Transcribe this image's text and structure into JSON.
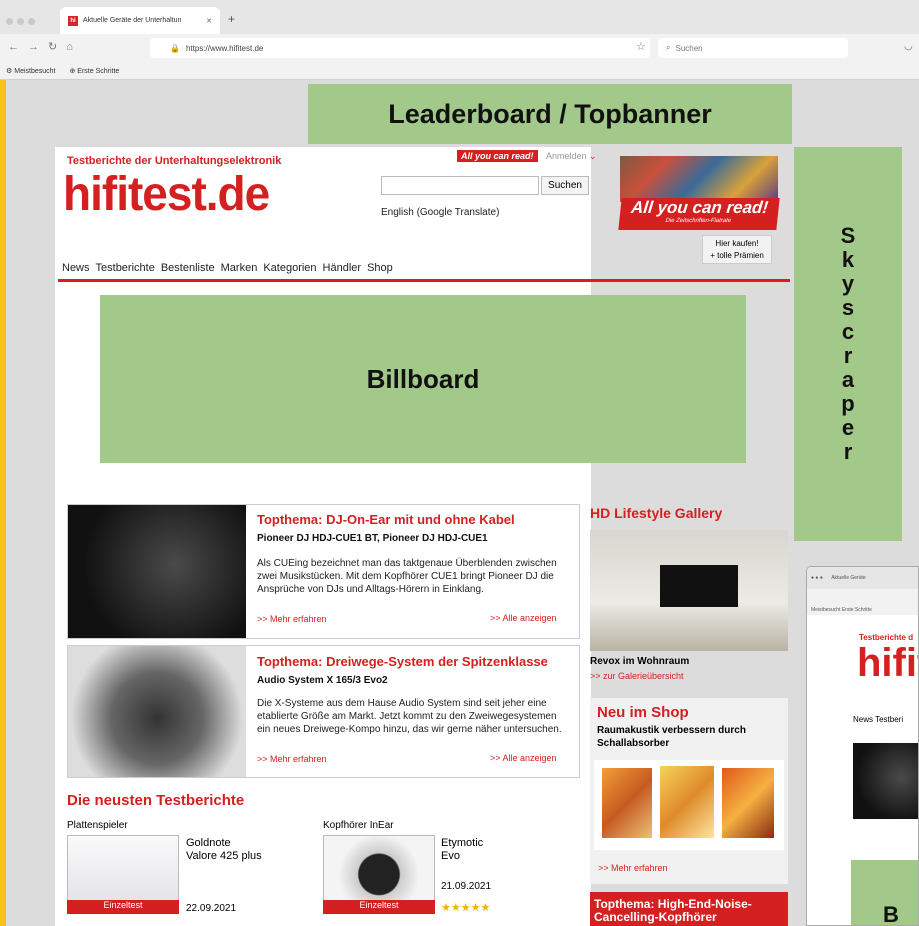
{
  "browser": {
    "tab_title": "Aktuelle Geräte der Unterhaltun",
    "favicon": "hi",
    "url": "https://www.hifitest.de",
    "search_placeholder": "Suchen",
    "bookmarks": [
      "Meistbesucht",
      "Erste Schritte"
    ]
  },
  "ads": {
    "leaderboard": "Leaderboard / Topbanner",
    "billboard": "Billboard",
    "skyscraper": [
      "S",
      "k",
      "y",
      "s",
      "c",
      "r",
      "a",
      "p",
      "e",
      "r"
    ]
  },
  "site": {
    "tagline": "Testberichte der Unterhaltungselektronik",
    "logo": "hifitest.de",
    "promo_tag": "All you can read!",
    "login": "Anmelden",
    "search_button": "Suchen",
    "translate": "English (Google Translate)",
    "magazine_banner": "All you can read!",
    "magazine_sub": "Die Zeitschriften-Flatrate",
    "buy_line1": "Hier kaufen!",
    "buy_line2": "+ tolle Prämien",
    "nav": [
      "News",
      "Testberichte",
      "Bestenliste",
      "Marken",
      "Kategorien",
      "Händler",
      "Shop"
    ]
  },
  "topics": [
    {
      "title": "Topthema: DJ-On-Ear mit und ohne Kabel",
      "subtitle": "Pioneer DJ HDJ-CUE1 BT, Pioneer DJ HDJ-CUE1",
      "text": "Als CUEing bezeichnet man das taktgenaue Überblenden zwischen zwei Musikstücken. Mit dem Kopfhörer CUE1 bringt Pioneer DJ die Ansprüche von DJs und Alltags-Hörern in Einklang.",
      "more": ">> Mehr erfahren",
      "all": ">> Alle anzeigen"
    },
    {
      "title": "Topthema: Dreiwege-System der Spitzenklasse",
      "subtitle": "Audio System X 165/3 Evo2",
      "text": "Die X-Systeme aus dem Hause Audio System sind seit jeher eine etablierte Größe am Markt. Jetzt kommt zu den Zweiwegesystemen ein neues Dreiwege-Kompo hinzu, das wir gerne näher untersuchen.",
      "more": ">> Mehr erfahren",
      "all": ">> Alle anzeigen"
    }
  ],
  "latest": {
    "heading": "Die neusten Testberichte",
    "items": [
      {
        "category": "Plattenspieler",
        "name1": "Goldnote",
        "name2": "Valore 425 plus",
        "badge": "Einzeltest",
        "date": "22.09.2021",
        "stars": ""
      },
      {
        "category": "Kopfhörer InEar",
        "name1": "Etymotic",
        "name2": "Evo",
        "badge": "Einzeltest",
        "date": "21.09.2021",
        "stars": "★★★★★"
      }
    ]
  },
  "sidebar": {
    "gallery_title": "HD Lifestyle Gallery",
    "gallery_caption": "Revox im Wohnraum",
    "gallery_link": ">> zur Galerieübersicht",
    "shop_title": "Neu im Shop",
    "shop_text": "Raumakustik verbessern durch Schallabsorber",
    "shop_link": ">> Mehr erfahren",
    "bottom_topic": "Topthema: High-End-Noise-Cancelling-Kopfhörer"
  },
  "mini": {
    "tab": "Aktuelle Geräte",
    "bookmarks": "Meistbesucht  Erste Schritte",
    "tagline": "Testberichte d",
    "logo": "hifit",
    "nav": "News  Testberi",
    "letter": "B"
  }
}
